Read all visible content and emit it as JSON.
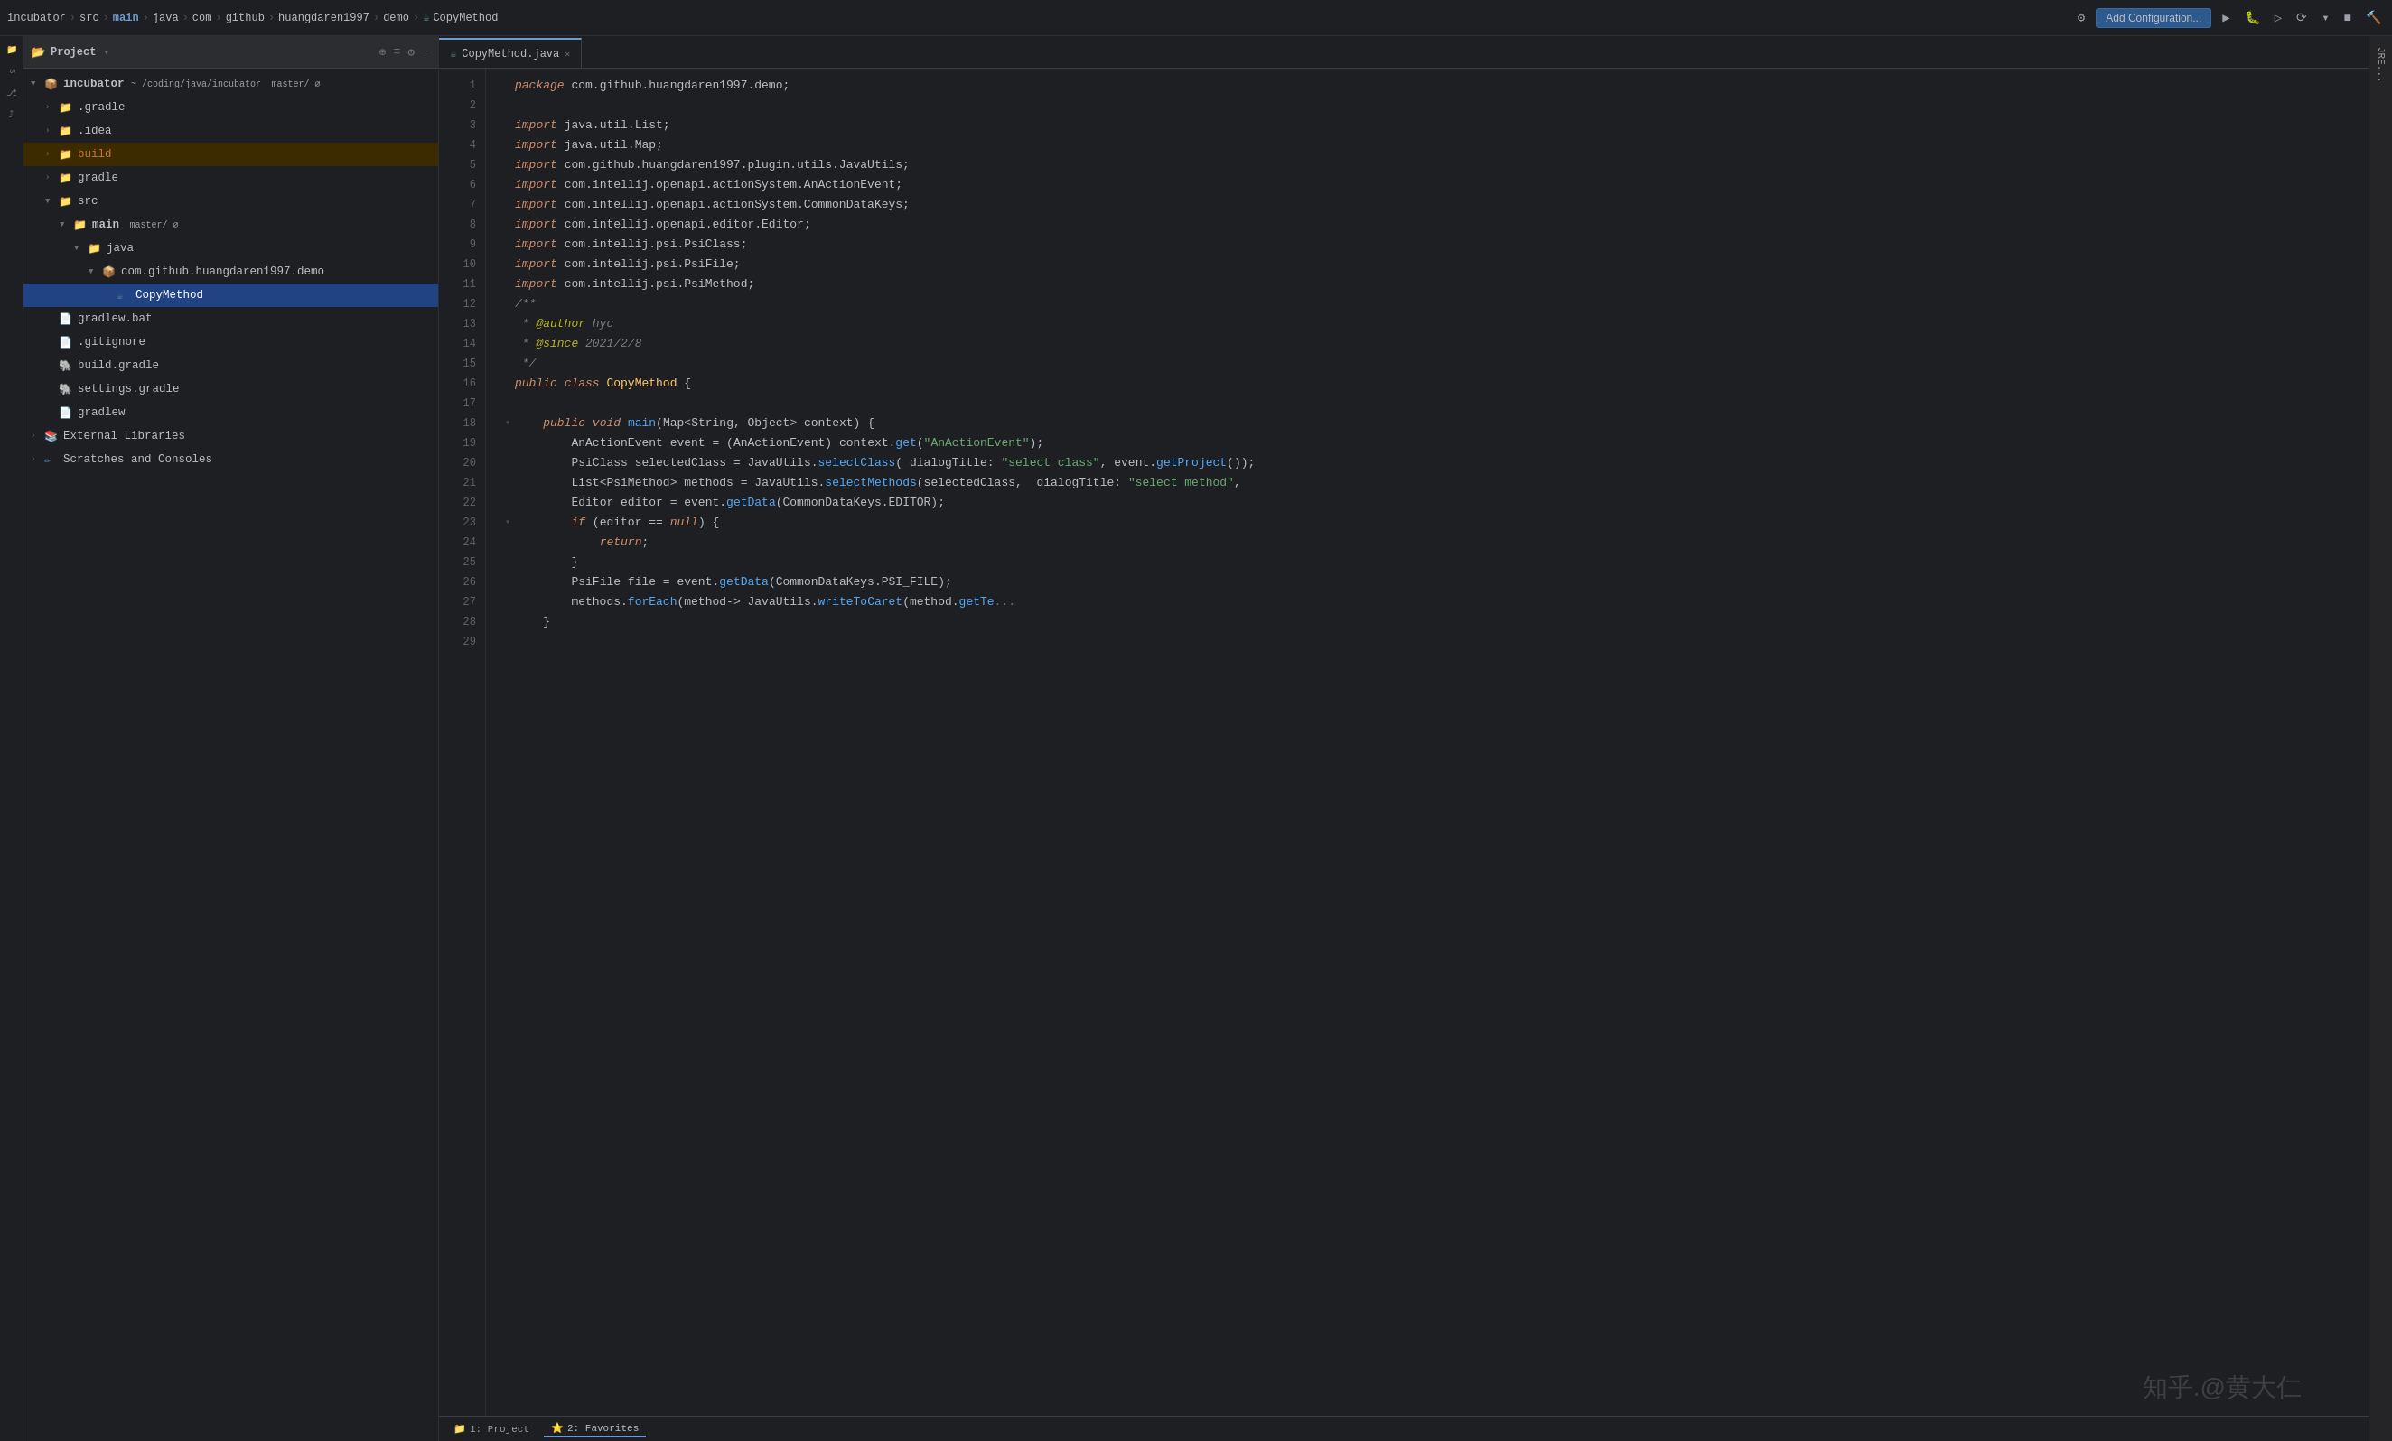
{
  "topbar": {
    "breadcrumb": [
      "incubator",
      "src",
      "main",
      "java",
      "com",
      "github",
      "huangdaren1997",
      "demo",
      "CopyMethod"
    ],
    "add_config_label": "Add Configuration...",
    "tab_label": "CopyMethod.java"
  },
  "sidebar": {
    "title": "Project",
    "root_label": "incubator",
    "root_path": "~ /coding/java/incubator master/ ∅",
    "items": [
      {
        "label": ".gradle",
        "indent": 2,
        "type": "folder-orange",
        "expanded": false
      },
      {
        "label": ".idea",
        "indent": 2,
        "type": "folder-yellow",
        "expanded": false
      },
      {
        "label": "build",
        "indent": 2,
        "type": "folder-orange",
        "expanded": false
      },
      {
        "label": "gradle",
        "indent": 2,
        "type": "folder",
        "expanded": false
      },
      {
        "label": "src",
        "indent": 2,
        "type": "folder",
        "expanded": true
      },
      {
        "label": "main master/ ∅",
        "indent": 3,
        "type": "folder-blue",
        "expanded": true
      },
      {
        "label": "java",
        "indent": 4,
        "type": "folder",
        "expanded": true
      },
      {
        "label": "com.github.huangdaren1997.demo",
        "indent": 5,
        "type": "folder",
        "expanded": true
      },
      {
        "label": "CopyMethod",
        "indent": 6,
        "type": "java",
        "selected": true
      },
      {
        "label": "gradlew.bat",
        "indent": 2,
        "type": "bat"
      },
      {
        "label": ".gitignore",
        "indent": 2,
        "type": "git"
      },
      {
        "label": "build.gradle",
        "indent": 2,
        "type": "gradle"
      },
      {
        "label": "settings.gradle",
        "indent": 2,
        "type": "gradle"
      },
      {
        "label": "gradlew",
        "indent": 2,
        "type": "file"
      },
      {
        "label": "External Libraries",
        "indent": 1,
        "type": "library",
        "expanded": false
      },
      {
        "label": "Scratches and Consoles",
        "indent": 1,
        "type": "scratch",
        "expanded": false
      }
    ]
  },
  "editor": {
    "tab_label": "CopyMethod.java",
    "code_lines": [
      {
        "n": 1,
        "text": "package com.github.huangdaren1997.demo;"
      },
      {
        "n": 2,
        "text": ""
      },
      {
        "n": 3,
        "text": "import java.util.List;"
      },
      {
        "n": 4,
        "text": "import java.util.Map;"
      },
      {
        "n": 5,
        "text": "import com.github.huangdaren1997.plugin.utils.JavaUtils;"
      },
      {
        "n": 6,
        "text": "import com.intellij.openapi.actionSystem.AnActionEvent;"
      },
      {
        "n": 7,
        "text": "import com.intellij.openapi.actionSystem.CommonDataKeys;"
      },
      {
        "n": 8,
        "text": "import com.intellij.openapi.editor.Editor;"
      },
      {
        "n": 9,
        "text": "import com.intellij.psi.PsiClass;"
      },
      {
        "n": 10,
        "text": "import com.intellij.psi.PsiFile;"
      },
      {
        "n": 11,
        "text": "import com.intellij.psi.PsiMethod;"
      },
      {
        "n": 12,
        "text": "/**"
      },
      {
        "n": 13,
        "text": " * @author hyc"
      },
      {
        "n": 14,
        "text": " * @since 2021/2/8"
      },
      {
        "n": 15,
        "text": " */"
      },
      {
        "n": 16,
        "text": "public class CopyMethod {"
      },
      {
        "n": 17,
        "text": ""
      },
      {
        "n": 18,
        "text": "    public void main(Map<String, Object> context) {"
      },
      {
        "n": 19,
        "text": "        AnActionEvent event = (AnActionEvent) context.get(\"AnActionEvent\");"
      },
      {
        "n": 20,
        "text": "        PsiClass selectedClass = JavaUtils.selectClass( dialogTitle: \"select class\", event.getProject());"
      },
      {
        "n": 21,
        "text": "        List<PsiMethod> methods = JavaUtils.selectMethods(selectedClass,  dialogTitle: \"select method\","
      },
      {
        "n": 22,
        "text": "        Editor editor = event.getData(CommonDataKeys.EDITOR);"
      },
      {
        "n": 23,
        "text": "        if (editor == null) {"
      },
      {
        "n": 24,
        "text": "            return;"
      },
      {
        "n": 25,
        "text": "        }"
      },
      {
        "n": 26,
        "text": "        PsiFile file = event.getData(CommonDataKeys.PSI_FILE);"
      },
      {
        "n": 27,
        "text": "        methods.forEach(method-> JavaUtils.writeToCaret(method.getTe..."
      },
      {
        "n": 28,
        "text": "    }"
      },
      {
        "n": 29,
        "text": ""
      }
    ]
  },
  "bottom_tabs": [
    {
      "label": "1: Project",
      "active": false
    },
    {
      "label": "2: Favorites",
      "active": false
    }
  ],
  "right_tabs": [
    {
      "label": "JRE..."
    }
  ],
  "watermark": "知乎.@黄大仁"
}
